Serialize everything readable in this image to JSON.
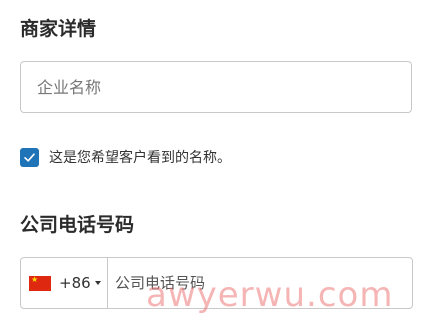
{
  "merchant_section": {
    "title": "商家详情",
    "company_name_placeholder": "企业名称",
    "display_name_checkbox": {
      "checked": true,
      "label": "这是您希望客户看到的名称。"
    }
  },
  "phone_section": {
    "title": "公司电话号码",
    "country_code": "+86",
    "country_flag": "china-flag-icon",
    "phone_placeholder": "公司电话号码"
  },
  "watermark": "awyerwu.com",
  "colors": {
    "accent": "#1f73b7",
    "border": "#c9c9c9",
    "watermark": "#ec7878",
    "flag_red": "#de2910",
    "flag_yellow": "#ffde00"
  }
}
